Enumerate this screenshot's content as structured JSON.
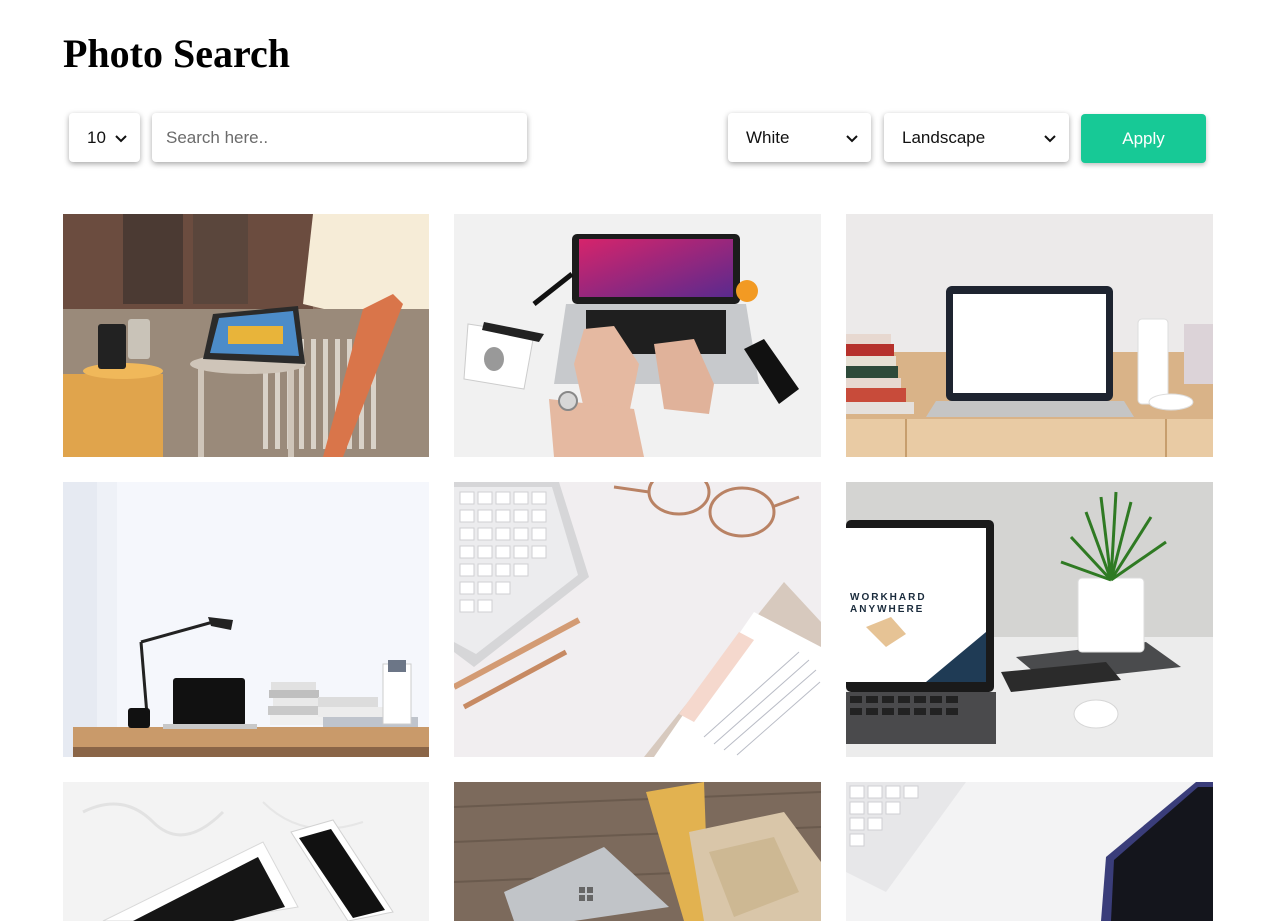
{
  "header": {
    "title": "Photo Search"
  },
  "controls": {
    "per_page_value": "10",
    "search_placeholder": "Search here..",
    "color_value": "White",
    "orientation_value": "Landscape",
    "apply_label": "Apply"
  },
  "photos": [
    {
      "subject": "tablet-on-stool-photo"
    },
    {
      "subject": "hands-typing-laptop-photo"
    },
    {
      "subject": "laptop-on-wooden-desk-photo"
    },
    {
      "subject": "minimal-desk-with-lamp-photo"
    },
    {
      "subject": "keyboard-glasses-notebook-photo"
    },
    {
      "subject": "laptop-with-plant-photo",
      "screen_text": [
        "WORKHARD",
        "ANYWHERE"
      ]
    },
    {
      "subject": "tablet-and-phone-on-marble-photo"
    },
    {
      "subject": "surface-laptop-and-packages-photo"
    },
    {
      "subject": "keyboard-and-dark-notebook-photo"
    }
  ],
  "colors": {
    "accent": "#17c996"
  }
}
